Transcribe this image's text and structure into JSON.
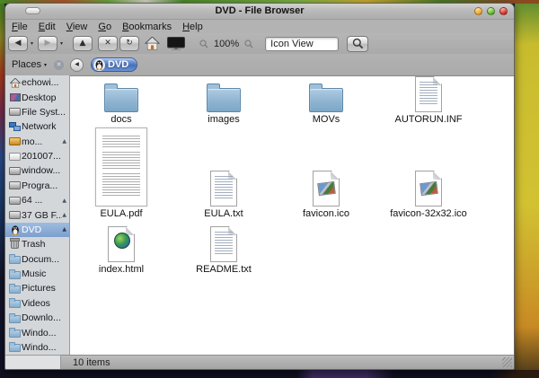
{
  "colors": {
    "selection_blue": "#8fb0d8",
    "folder_blue": "#8fb4d2",
    "breadcrumb_blue": "#5580c4",
    "titlebar_gray": "#b2b2b2",
    "sidebar_gray": "#d4d7da",
    "traffic_yellow": "#f0a832",
    "traffic_green": "#62b832",
    "traffic_red": "#d8322a"
  },
  "window": {
    "title": "DVD - File Browser",
    "status": "10 items"
  },
  "menu": {
    "items": [
      {
        "m": "F",
        "rest": "ile"
      },
      {
        "m": "E",
        "rest": "dit"
      },
      {
        "m": "V",
        "rest": "iew"
      },
      {
        "m": "G",
        "rest": "o"
      },
      {
        "m": "B",
        "rest": "ookmarks"
      },
      {
        "m": "H",
        "rest": "elp"
      }
    ]
  },
  "toolbar": {
    "zoom_level": "100%",
    "view_mode": "Icon View"
  },
  "icons": {
    "back": "◀",
    "forward": "▶",
    "up": "▲",
    "stop": "✕",
    "refresh": "↻",
    "dropdown": "▾",
    "eject": "▲",
    "close": "✕"
  },
  "sidebar": {
    "header": "Places",
    "items": [
      {
        "label": "echowi...",
        "icon": "home"
      },
      {
        "label": "Desktop",
        "icon": "desktop-image"
      },
      {
        "label": "File Syst...",
        "icon": "drive"
      },
      {
        "label": "Network",
        "icon": "network"
      },
      {
        "label": "mo...",
        "icon": "drive-orange",
        "eject": true
      },
      {
        "label": "201007...",
        "icon": "drive-white"
      },
      {
        "label": "window...",
        "icon": "drive"
      },
      {
        "label": "Progra...",
        "icon": "drive"
      },
      {
        "label": "64 ...",
        "icon": "drive",
        "eject": true
      },
      {
        "label": "37 GB F...",
        "icon": "drive",
        "eject": true
      },
      {
        "label": "DVD",
        "icon": "tux",
        "eject": true,
        "selected": true
      },
      {
        "label": "Trash",
        "icon": "trash"
      },
      {
        "label": "Docum...",
        "icon": "folder"
      },
      {
        "label": "Music",
        "icon": "folder"
      },
      {
        "label": "Pictures",
        "icon": "folder"
      },
      {
        "label": "Videos",
        "icon": "folder"
      },
      {
        "label": "Downlo...",
        "icon": "folder"
      },
      {
        "label": "Windo...",
        "icon": "folder"
      },
      {
        "label": "Windo...",
        "icon": "folder"
      }
    ]
  },
  "pathbar": {
    "location": "DVD"
  },
  "files": [
    {
      "name": "docs",
      "type": "folder"
    },
    {
      "name": "images",
      "type": "folder"
    },
    {
      "name": "MOVs",
      "type": "folder"
    },
    {
      "name": "AUTORUN.INF",
      "type": "text"
    },
    {
      "name": "EULA.pdf",
      "type": "pdf"
    },
    {
      "name": "EULA.txt",
      "type": "text"
    },
    {
      "name": "favicon.ico",
      "type": "image"
    },
    {
      "name": "favicon-32x32.ico",
      "type": "image"
    },
    {
      "name": "index.html",
      "type": "html"
    },
    {
      "name": "README.txt",
      "type": "text"
    }
  ]
}
